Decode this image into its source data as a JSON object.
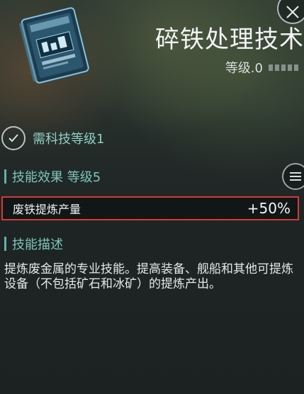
{
  "skill": {
    "title": "碎铁处理技术",
    "level_label": "等级.0",
    "level_pips": 5
  },
  "requirement": {
    "text": "需科技等级1"
  },
  "effects_section": {
    "header": "技能效果 等级5",
    "rows": [
      {
        "label": "废铁提炼产量",
        "value": "+50%"
      }
    ]
  },
  "description_section": {
    "header": "技能描述",
    "text": "提炼废金属的专业技能。提高装备、舰船和其他可提炼设备（不包括矿石和冰矿）的提炼产出。"
  },
  "icons": {
    "close": "close-icon",
    "menu": "menu-icon",
    "check": "check-icon",
    "module": "skill-module-icon"
  },
  "colors": {
    "accent": "#7cc6ba",
    "highlight_border": "#d43a3a"
  }
}
